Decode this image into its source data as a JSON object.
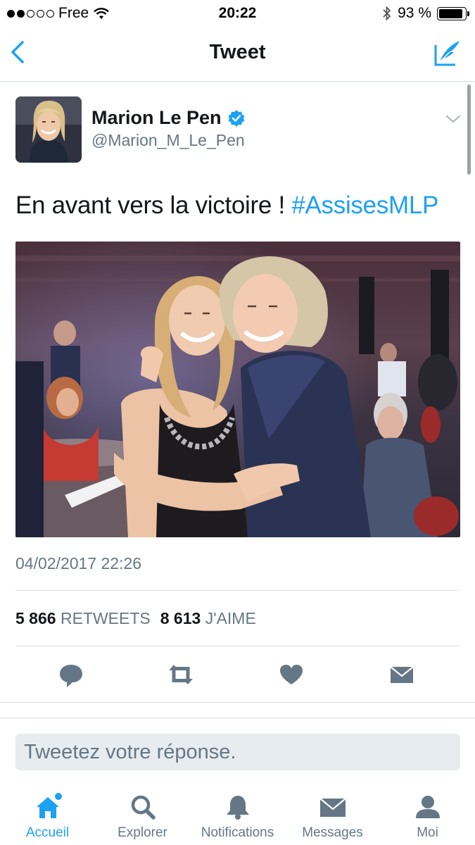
{
  "status_bar": {
    "carrier": "Free",
    "time": "20:22",
    "battery_percent": "93 %",
    "battery_level": 0.93,
    "signal_bars_filled": 2
  },
  "nav": {
    "title": "Tweet",
    "back_icon": "chevron-left-icon",
    "compose_icon": "compose-quill-icon"
  },
  "tweet": {
    "author_name": "Marion Le Pen",
    "author_handle": "@Marion_M_Le_Pen",
    "verified": true,
    "text": "En avant vers la victoire ! ",
    "hashtag": "#AssisesMLP",
    "timestamp": "04/02/2017 22:26",
    "retweets_count": "5 866",
    "retweets_label": "RETWEETS",
    "likes_count": "8 613",
    "likes_label": "J'AIME"
  },
  "actions": [
    "reply-icon",
    "retweet-icon",
    "like-heart-icon",
    "message-envelope-icon"
  ],
  "reply": {
    "placeholder": "Tweetez votre réponse."
  },
  "tabs": [
    {
      "label": "Accueil",
      "icon": "home-icon",
      "active": true
    },
    {
      "label": "Explorer",
      "icon": "search-icon",
      "active": false
    },
    {
      "label": "Notifications",
      "icon": "bell-icon",
      "active": false
    },
    {
      "label": "Messages",
      "icon": "envelope-icon",
      "active": false
    },
    {
      "label": "Moi",
      "icon": "person-icon",
      "active": false
    }
  ],
  "colors": {
    "accent": "#1da1f2",
    "secondary_text": "#657786",
    "primary_text": "#14171a",
    "divider": "#d8dde2"
  }
}
